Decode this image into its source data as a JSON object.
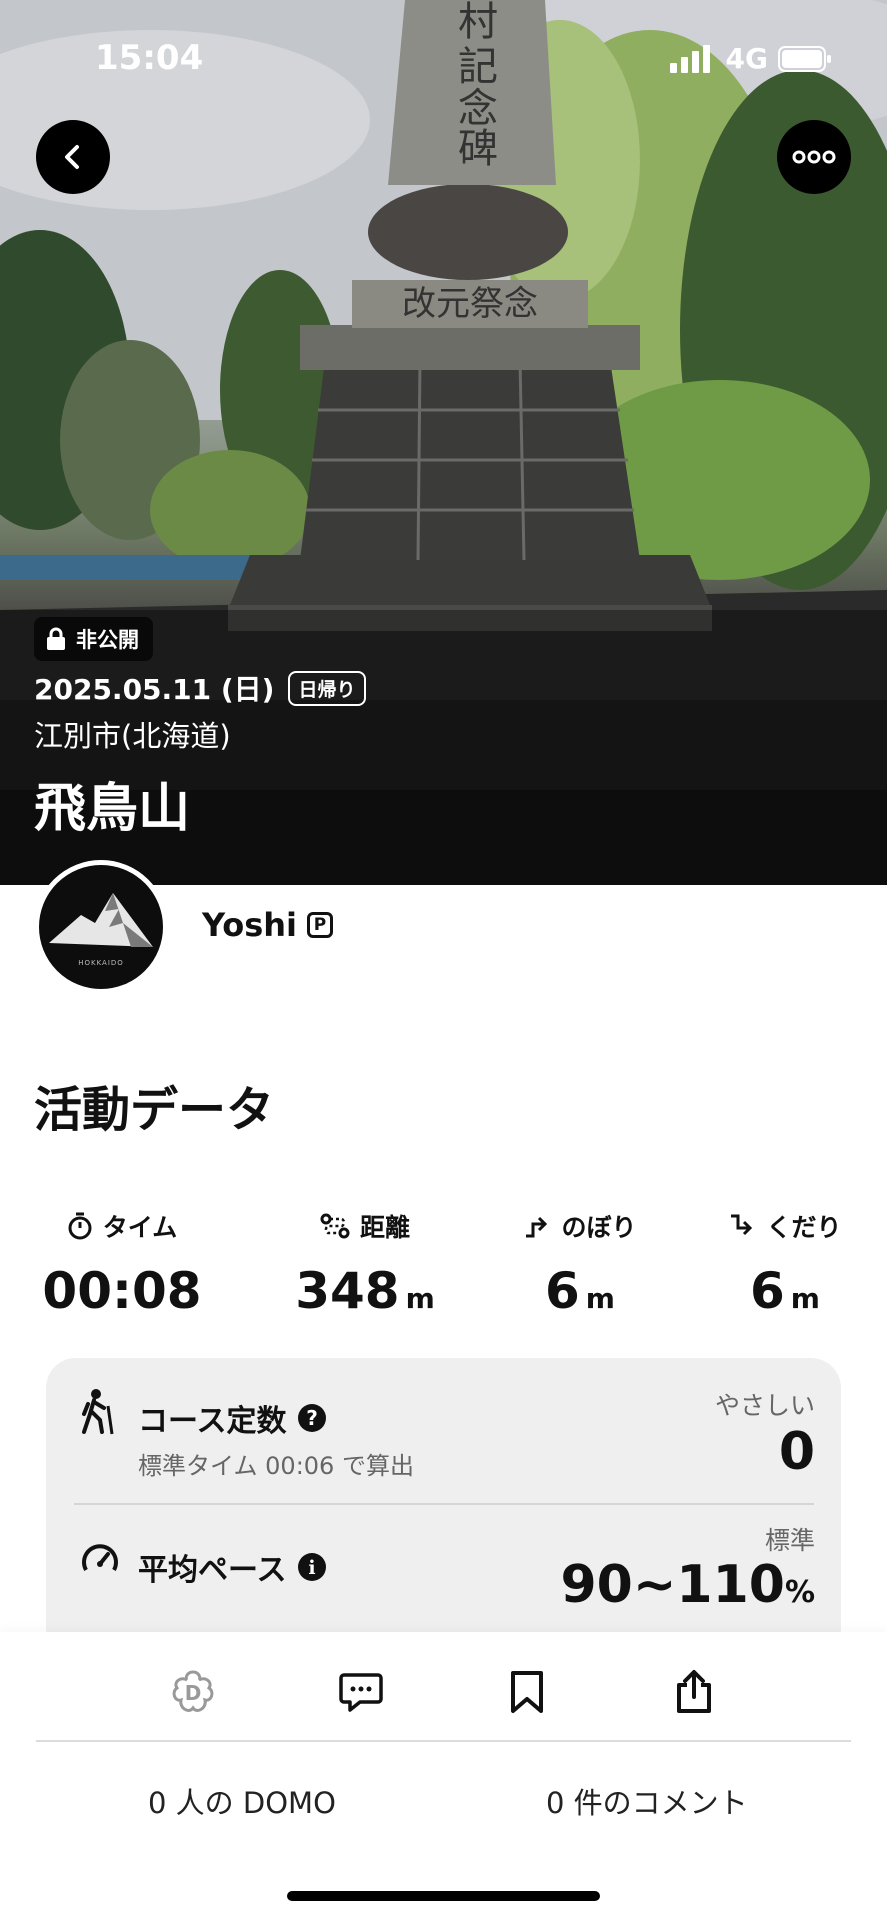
{
  "status_bar": {
    "time": "15:04",
    "network": "4G"
  },
  "hero": {
    "visibility": "非公開",
    "date": "2025.05.11 (日)",
    "trip_type": "日帰り",
    "location": "江別市(北海道)",
    "mountain": "飛鳥山"
  },
  "user": {
    "name": "Yoshi",
    "badge": "P",
    "avatar_text": "HOKKAIDO"
  },
  "activity": {
    "title": "活動データ",
    "stats": [
      {
        "label": "タイム",
        "value": "00:08",
        "unit": "",
        "icon": "stopwatch-icon"
      },
      {
        "label": "距離",
        "value": "348",
        "unit": "m",
        "icon": "route-icon"
      },
      {
        "label": "のぼり",
        "value": "6",
        "unit": "m",
        "icon": "ascent-icon"
      },
      {
        "label": "くだり",
        "value": "6",
        "unit": "m",
        "icon": "descent-icon"
      }
    ],
    "course_constant": {
      "title": "コース定数",
      "subtitle": "標準タイム 00:06 で算出",
      "difficulty": "やさしい",
      "value": "0"
    },
    "average_pace": {
      "title": "平均ペース",
      "label": "標準",
      "value": "90~110",
      "unit": "%"
    }
  },
  "social": {
    "domo_count": "0 人の DOMO",
    "comment_count": "0 件のコメント"
  }
}
